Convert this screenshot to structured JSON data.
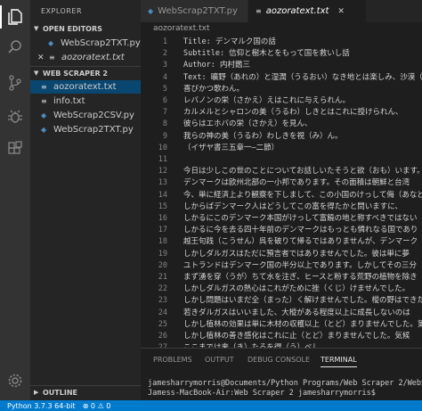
{
  "activity_bar": {
    "icons": [
      "files-icon",
      "search-icon",
      "source-control-icon",
      "debug-icon",
      "extensions-icon",
      "settings-gear-icon"
    ]
  },
  "sidebar": {
    "title": "EXPLORER",
    "open_editors_label": "OPEN EDITORS",
    "open_editors": [
      {
        "name": "WebScrap2TXT.py"
      },
      {
        "name": "aozoratext.txt"
      }
    ],
    "project_label": "WEB SCRAPER 2",
    "files": [
      {
        "name": "aozoratext.txt"
      },
      {
        "name": "info.txt"
      },
      {
        "name": "WebScrap2CSV.py"
      },
      {
        "name": "WebScrap2TXT.py"
      }
    ],
    "outline_label": "OUTLINE"
  },
  "tabs": [
    {
      "label": "WebScrap2TXT.py"
    },
    {
      "label": "aozoratext.txt"
    }
  ],
  "breadcrumb": "aozoratext.txt",
  "editor": {
    "lines": [
      {
        "n": "1",
        "text": "Title: デンマルク国の話"
      },
      {
        "n": "2",
        "text": "Subtitle: 信仰と樹木とをもって国を救いし話"
      },
      {
        "n": "3",
        "text": "Author: 内村鑑三"
      },
      {
        "n": "4",
        "text": "Text: 曠野（あれの）と湿潤（うるおい）なき地とは楽しみ、沙漠（さばく）は"
      },
      {
        "n": "5",
        "text": "喜びかつ歌わん。"
      },
      {
        "n": "6",
        "text": "レバノンの栄（さかえ）えはこれに与えられん。"
      },
      {
        "n": "7",
        "text": "カルメルとシャロンの美（うるわ）しきとはこれに授けられん、"
      },
      {
        "n": "8",
        "text": "彼らはエホバの栄（さかえ）を見ん、"
      },
      {
        "n": "9",
        "text": "我らの神の美（うるわ）わしきを視（み）ん。"
      },
      {
        "n": "10",
        "text": "（イザヤ書三五章一―二節）"
      },
      {
        "n": "11",
        "text": ""
      },
      {
        "n": "12",
        "text": "今日は少しこの世のことについてお話しいたそうと欲（おも）います。"
      },
      {
        "n": "13",
        "text": "デンマークは欧州北部の一小邦であります。その面積は朝鮮と台湾"
      },
      {
        "n": "14",
        "text": "今、単に経済上より観察を下しまして、この小国のけっして侮（あなど）"
      },
      {
        "n": "15",
        "text": "しからばデンマーク人はどうしてこの富を得たかと問いますに、"
      },
      {
        "n": "16",
        "text": "しかるにこのデンマーク本国がけっして富饒の地と称すべきではない"
      },
      {
        "n": "17",
        "text": "しかるに今を去る四十年前のデンマークはもっとも憐れなる国であり"
      },
      {
        "n": "18",
        "text": "越王句践（こうせん）呉を破りて帰るではありませんが、デンマーク"
      },
      {
        "n": "19",
        "text": "しかしダルガスはただに預言者ではありませんでした。彼は単に夢"
      },
      {
        "n": "20",
        "text": "ユトランドはデンマーク国の半分以上であります。しかしてその三分"
      },
      {
        "n": "21",
        "text": "まず湧を穿（うが）ちて水を注ぎ、ヒースと粉する荒野の植物を除き"
      },
      {
        "n": "22",
        "text": "しかしダルガスの熱心はこれがために挫（くじ）けませんでした。"
      },
      {
        "n": "23",
        "text": "しかし問題はいまだ全（まった）く解けませんでした。樅の野はできた"
      },
      {
        "n": "24",
        "text": "若きダルガスはいいました、大樅がある程度以上に成長しないのは"
      },
      {
        "n": "25",
        "text": "しかし植林の効果は単に木材の収穫以上（とど）まりませんでした。第一"
      },
      {
        "n": "26",
        "text": "しかし植林の善き感化はこれに止（とど）まりませんでした。気候"
      },
      {
        "n": "27",
        "text": "ここまでは来（き）たるを得（う）べし"
      },
      {
        "n": "28",
        "text": "しかしここを越ゆべからず"
      }
    ]
  },
  "panel": {
    "tabs": [
      "PROBLEMS",
      "OUTPUT",
      "DEBUG CONSOLE",
      "TERMINAL"
    ],
    "active_tab": "TERMINAL",
    "terminal_lines": [
      "jamesharrymorris@Documents/Python Programs/Web Scraper 2/WebScrap2",
      "Jamess-MacBook-Air:Web Scraper 2 jamesharrymorris$ "
    ]
  },
  "status_bar": {
    "python": "Python 3.7.3 64-bit",
    "errors": "⊗ 0 ⚠ 0"
  },
  "colors": {
    "activity_bar": "#333333",
    "sidebar": "#252526",
    "editor": "#1e1e1e",
    "selection": "#094771",
    "status_bar": "#007acc"
  }
}
